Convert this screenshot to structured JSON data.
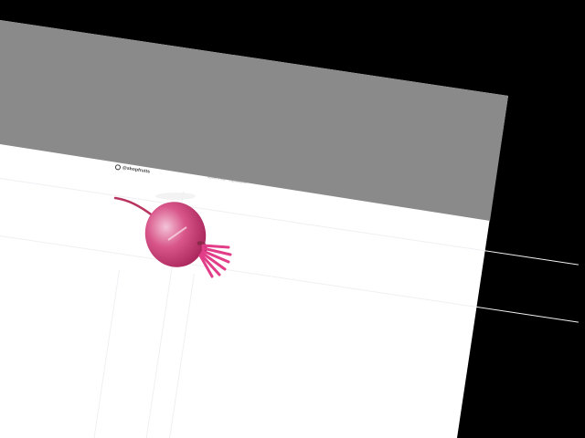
{
  "header": {
    "logo_text": "@shopfruits",
    "nav_text": "about fruits · ingredients"
  },
  "product": {
    "icon": "beet-icon",
    "color": "#d4457f"
  },
  "colors": {
    "background": "#000000",
    "header": "#8a8a8a",
    "page": "#ffffff"
  }
}
